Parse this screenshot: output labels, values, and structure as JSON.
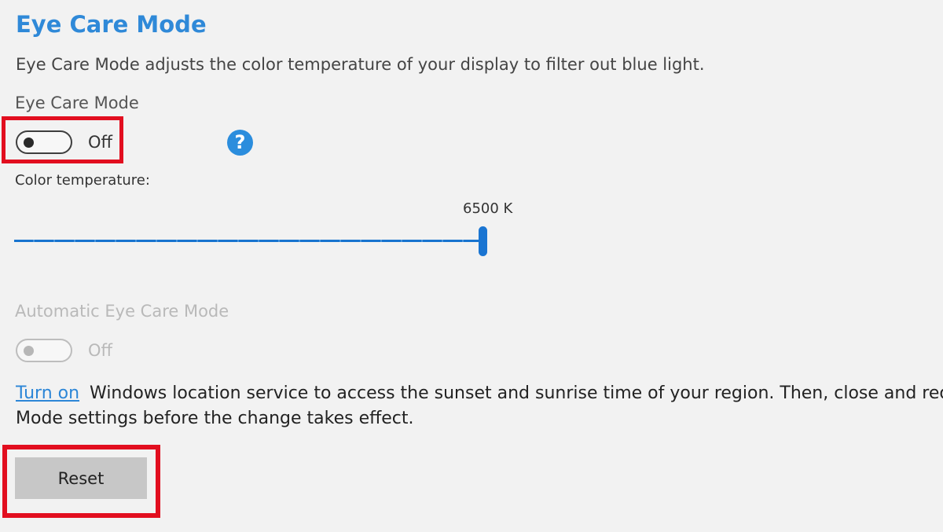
{
  "page": {
    "title": "Eye Care Mode",
    "description": "Eye Care Mode adjusts the color temperature of your display to filter out blue light."
  },
  "eye_care_toggle": {
    "label": "Eye Care Mode",
    "state_text": "Off",
    "enabled": false,
    "help_icon": "question-circle-icon",
    "help_symbol": "?"
  },
  "color_temperature": {
    "label": "Color temperature:",
    "value_text": "6500 K",
    "value": 6500,
    "fraction": 1.0
  },
  "automatic_eye_care": {
    "label": "Automatic Eye Care Mode",
    "state_text": "Off",
    "enabled": false,
    "disabled": true
  },
  "notice": {
    "link_text": "Turn on",
    "line1": "Windows location service to access the sunset and sunrise time of your region. Then, close and reo",
    "line2": "Mode settings before the change takes effect."
  },
  "actions": {
    "reset_label": "Reset"
  },
  "colors": {
    "accent": "#2f89d8",
    "slider": "#1a75d2",
    "highlight": "#e20e1f",
    "background": "#f2f2f2"
  }
}
